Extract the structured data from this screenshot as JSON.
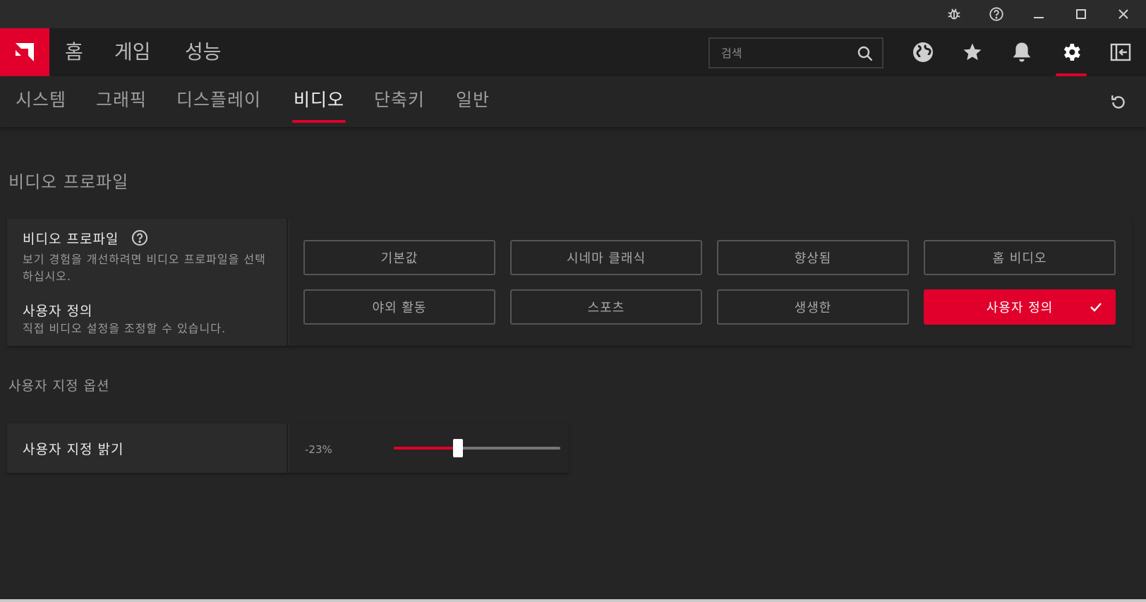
{
  "app": {
    "brand_color": "#e0002b",
    "logo_icon": "amd-logo-icon"
  },
  "titlebar": {
    "buttons": [
      "bug-icon",
      "help-icon",
      "minimize-icon",
      "maximize-icon",
      "close-icon"
    ]
  },
  "main_nav": {
    "items": [
      {
        "label": "홈"
      },
      {
        "label": "게임"
      },
      {
        "label": "성능"
      }
    ],
    "search": {
      "placeholder": "검색",
      "value": ""
    },
    "icons": [
      "globe-icon",
      "star-icon",
      "bell-icon",
      "gear-icon",
      "sidebar-toggle-icon"
    ],
    "active_icon": "gear-icon"
  },
  "sub_nav": {
    "items": [
      {
        "label": "시스템"
      },
      {
        "label": "그래픽"
      },
      {
        "label": "디스플레이"
      },
      {
        "label": "비디오"
      },
      {
        "label": "단축키"
      },
      {
        "label": "일반"
      }
    ],
    "active": "비디오",
    "reset_icon": "reset-icon"
  },
  "video_profile": {
    "section_title": "비디오 프로파일",
    "label_title": "비디오 프로파일",
    "label_desc": "보기 경험을 개선하려면 비디오 프로파일을 선택하십시오.",
    "custom_title": "사용자 정의",
    "custom_desc": "직접 비디오 설정을 조정할 수 있습니다.",
    "options": [
      {
        "label": "기본값",
        "selected": false
      },
      {
        "label": "시네마 클래식",
        "selected": false
      },
      {
        "label": "향상됨",
        "selected": false
      },
      {
        "label": "홈 비디오",
        "selected": false
      },
      {
        "label": "야외 활동",
        "selected": false
      },
      {
        "label": "스포츠",
        "selected": false
      },
      {
        "label": "생생한",
        "selected": false
      },
      {
        "label": "사용자 정의",
        "selected": true
      }
    ]
  },
  "custom_options": {
    "section_title": "사용자 지정 옵션",
    "brightness": {
      "label": "사용자 지정 밝기",
      "value_text": "-23%",
      "value": -23,
      "min": -100,
      "max": 100
    }
  }
}
